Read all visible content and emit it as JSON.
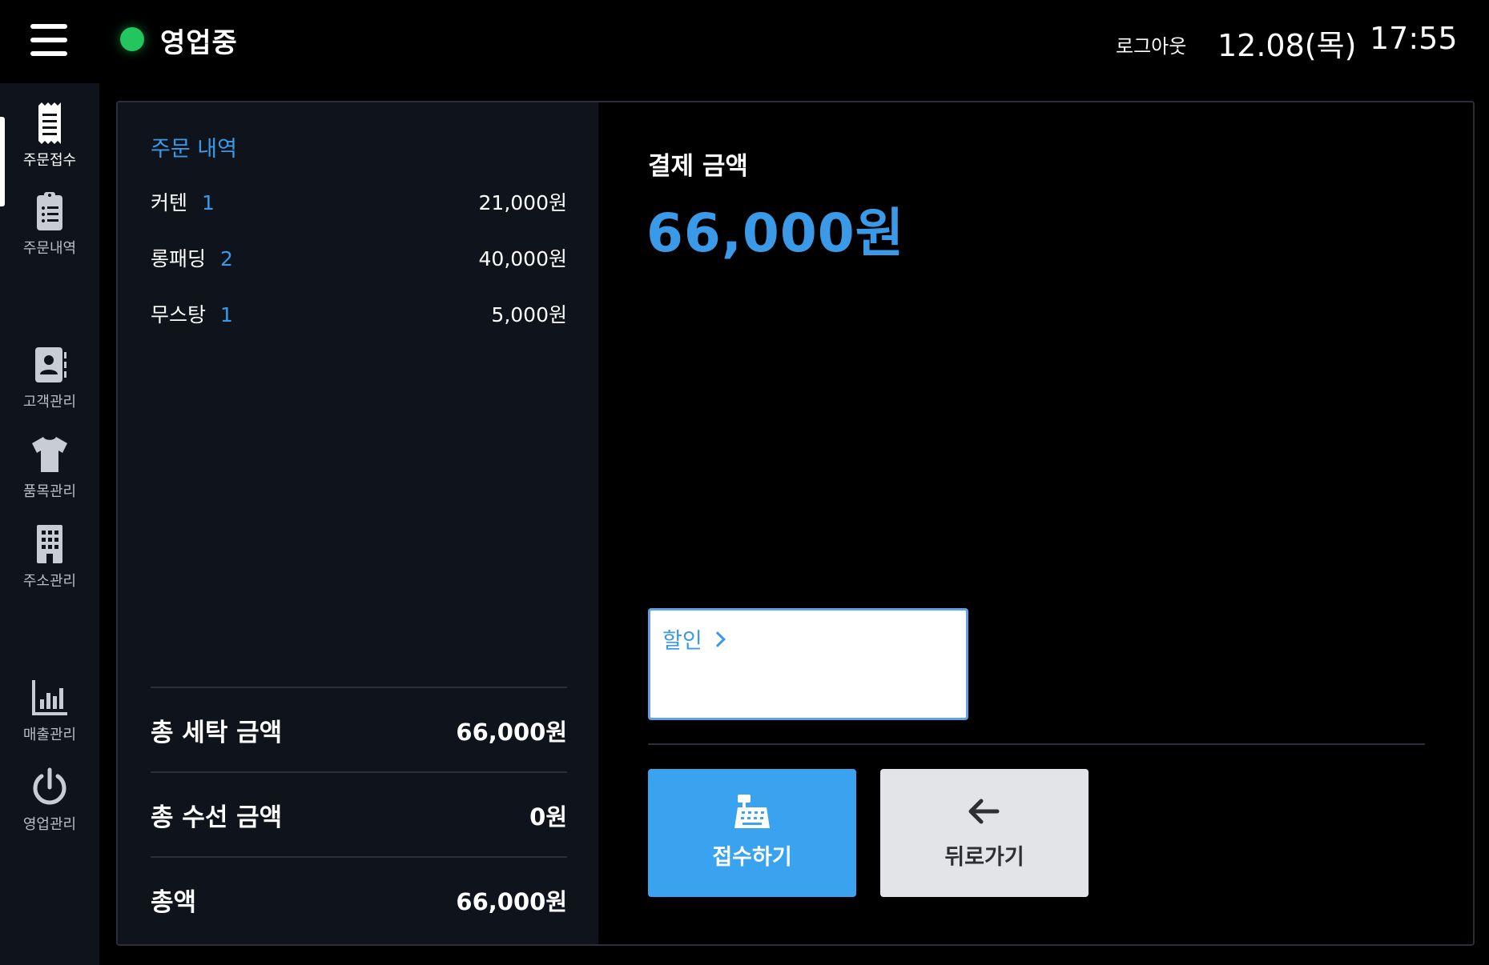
{
  "header": {
    "status": "영업중",
    "status_color": "#22c55e",
    "logout": "로그아웃",
    "date": "12.08(목)",
    "time": "17:55"
  },
  "sidebar": {
    "items": [
      {
        "label": "주문접수",
        "icon": "receipt-icon",
        "active": true
      },
      {
        "label": "주문내역",
        "icon": "clipboard-list-icon"
      },
      {
        "label": "고객관리",
        "icon": "contact-book-icon"
      },
      {
        "label": "품목관리",
        "icon": "shirt-icon"
      },
      {
        "label": "주소관리",
        "icon": "building-icon"
      },
      {
        "label": "매출관리",
        "icon": "bar-chart-icon"
      },
      {
        "label": "영업관리",
        "icon": "power-icon"
      }
    ]
  },
  "order": {
    "title": "주문 내역",
    "items": [
      {
        "name": "커텐",
        "qty": "1",
        "price": "21,000원"
      },
      {
        "name": "롱패딩",
        "qty": "2",
        "price": "40,000원"
      },
      {
        "name": "무스탕",
        "qty": "1",
        "price": "5,000원"
      }
    ],
    "summary": [
      {
        "label": "총 세탁 금액",
        "value": "66,000원"
      },
      {
        "label": "총 수선 금액",
        "value": "0원"
      },
      {
        "label": "총액",
        "value": "66,000원"
      }
    ]
  },
  "payment": {
    "label": "결제 금액",
    "amount": "66,000원",
    "discount_label": "할인"
  },
  "actions": {
    "receive": "접수하기",
    "back": "뒤로가기"
  },
  "colors": {
    "accent": "#3b9ae8",
    "primary_button": "#3aa3f0",
    "secondary_button": "#e3e4e8",
    "sidebar_bg": "#0f131b"
  }
}
